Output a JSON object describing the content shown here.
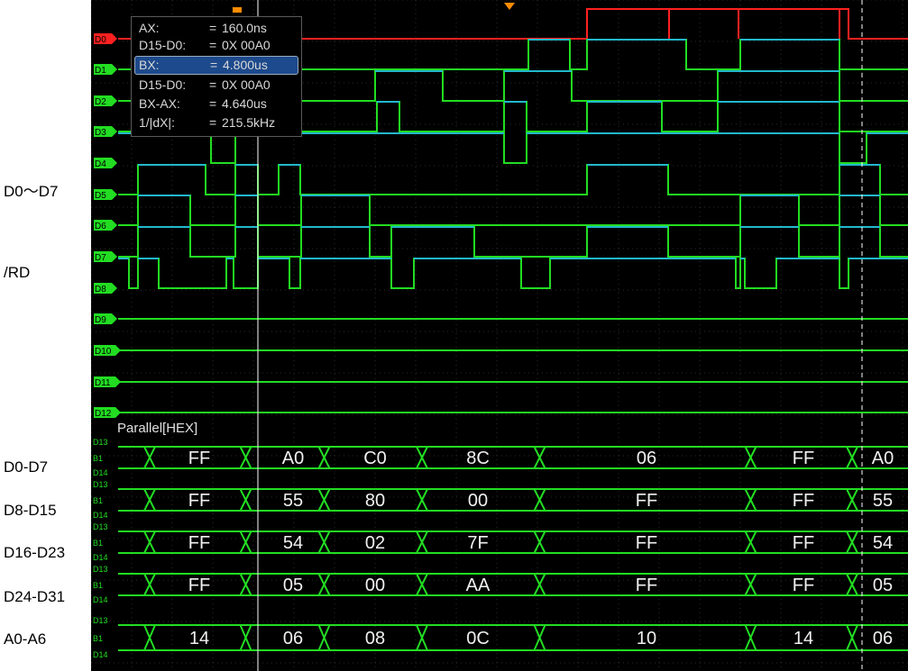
{
  "side_labels": {
    "d0_d7_wave": "D0～D7",
    "rd": "/RD",
    "bus1": "D0-D7",
    "bus2": "D8-D15",
    "bus3": "D16-D23",
    "bus4": "D24-D31",
    "bus5": "A0-A6"
  },
  "cursor_panel": {
    "ax_label": "AX:",
    "ax_eq": "=",
    "ax_value": "160.0ns",
    "d1_label": "D15-D0:",
    "d1_eq": "=",
    "d1_value": "0X 00A0",
    "bx_label": "BX:",
    "bx_eq": "=",
    "bx_value": "4.800us",
    "d2_label": "D15-D0:",
    "d2_eq": "=",
    "d2_value": "0X 00A0",
    "bxax_label": "BX-AX:",
    "bxax_eq": "=",
    "bxax_value": "4.640us",
    "freq_label": "1/|dX|:",
    "freq_eq": "=",
    "freq_value": "215.5kHz"
  },
  "channels": [
    "D0",
    "D1",
    "D2",
    "D3",
    "D4",
    "D5",
    "D6",
    "D7",
    "D8",
    "D9",
    "D10",
    "D11",
    "D12"
  ],
  "bus_tags": [
    "D13",
    "B1",
    "D14"
  ],
  "parallel_label": "Parallel[HEX]",
  "buses": [
    [
      "FF",
      "A0",
      "C0",
      "8C",
      "06",
      "FF",
      "A0"
    ],
    [
      "FF",
      "55",
      "80",
      "00",
      "FF",
      "FF",
      "55"
    ],
    [
      "FF",
      "54",
      "02",
      "7F",
      "FF",
      "FF",
      "54"
    ],
    [
      "FF",
      "05",
      "00",
      "AA",
      "FF",
      "FF",
      "05"
    ],
    [
      "14",
      "06",
      "08",
      "0C",
      "10",
      "14",
      "06"
    ]
  ],
  "colors": {
    "active_channel": "#ff2020",
    "trace": "#22dd22",
    "trace_high": "#22b8cc",
    "trigger_marker": "#ff8c00"
  }
}
